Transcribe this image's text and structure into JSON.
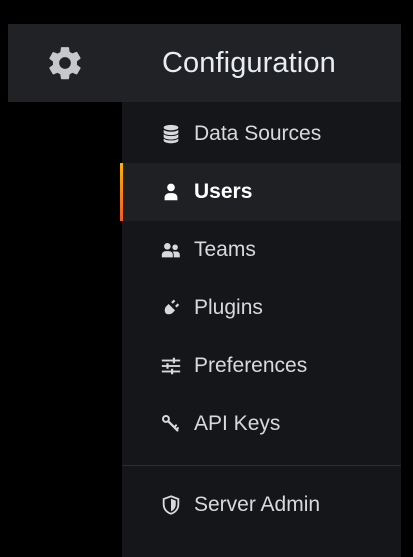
{
  "rail": {
    "icon": "gear-icon"
  },
  "panel": {
    "title": "Configuration"
  },
  "menu": {
    "items": [
      {
        "label": "Data Sources",
        "icon": "database-icon",
        "active": false
      },
      {
        "label": "Users",
        "icon": "user-icon",
        "active": true
      },
      {
        "label": "Teams",
        "icon": "users-icon",
        "active": false
      },
      {
        "label": "Plugins",
        "icon": "plug-icon",
        "active": false
      },
      {
        "label": "Preferences",
        "icon": "sliders-icon",
        "active": false
      },
      {
        "label": "API Keys",
        "icon": "key-icon",
        "active": false
      }
    ],
    "footer": [
      {
        "label": "Server Admin",
        "icon": "shield-icon",
        "active": false
      }
    ]
  },
  "colors": {
    "accent_top": "#ffb300",
    "accent_bottom": "#f05a28",
    "panel_bg": "#141619",
    "header_bg": "#202226"
  }
}
